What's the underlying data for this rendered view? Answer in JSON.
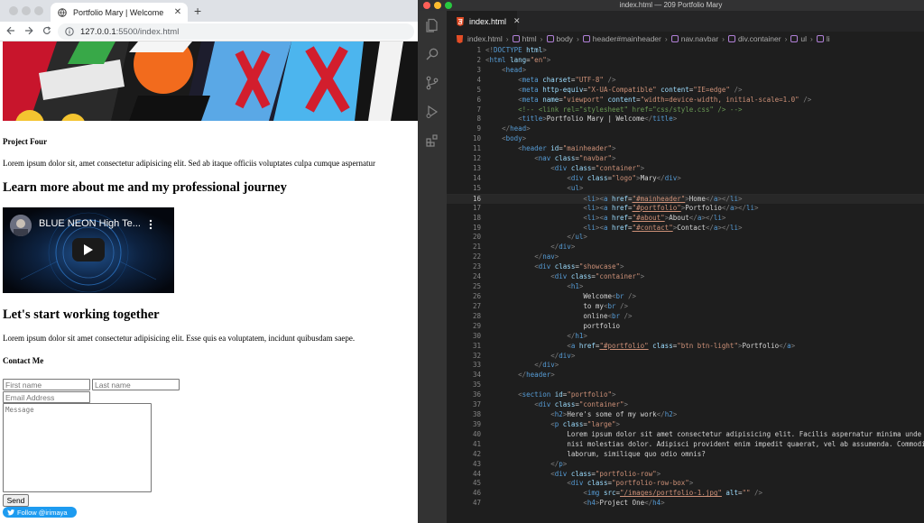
{
  "browser": {
    "tab_title": "Portfolio Mary | Welcome",
    "tab_close": "✕",
    "new_tab": "+",
    "url_host": "127.0.0.1",
    "url_rest": ":5500/index.html"
  },
  "page": {
    "project_heading": "Project Four",
    "project_text": "Lorem ipsum dolor sit, amet consectetur adipisicing elit. Sed ab itaque officiis voluptates culpa cumque aspernatur",
    "about_heading": "Learn more about me and my professional journey",
    "video_title": "BLUE NEON High Te...",
    "work_heading": "Let's start working together",
    "work_text": "Lorem ipsum dolor sit amet consectetur adipisicing elit. Esse quis ea voluptatem, incidunt quibusdam saepe.",
    "contact_heading": "Contact Me",
    "first_name_placeholder": "First name",
    "last_name_placeholder": "Last name",
    "email_placeholder": "Email Address",
    "message_placeholder": "Message",
    "send_label": "Send",
    "twitter_label": "Follow @irimaya"
  },
  "editor": {
    "window_title": "index.html — 209 Portfolio Mary",
    "tab_label": "index.html",
    "tab_close": "✕",
    "breadcrumbs": [
      "index.html",
      "html",
      "body",
      "header#mainheader",
      "nav.navbar",
      "div.container",
      "ul",
      "li"
    ],
    "current_line": 16,
    "lines": [
      "<!DOCTYPE html>",
      "<html lang=\"en\">",
      "    <head>",
      "        <meta charset=\"UTF-8\" />",
      "        <meta http-equiv=\"X-UA-Compatible\" content=\"IE=edge\" />",
      "        <meta name=\"viewport\" content=\"width=device-width, initial-scale=1.0\" />",
      "        <!-- <link rel=\"stylesheet\" href=\"css/style.css\" /> -->",
      "        <title>Portfolio Mary | Welcome</title>",
      "    </head>",
      "    <body>",
      "        <header id=\"mainheader\">",
      "            <nav class=\"navbar\">",
      "                <div class=\"container\">",
      "                    <div class=\"logo\">Mary</div>",
      "                    <ul>",
      "                        <li><a href=\"#mainheader\">Home</a></li>",
      "                        <li><a href=\"#portfolio\">Portfolio</a></li>",
      "                        <li><a href=\"#about\">About</a></li>",
      "                        <li><a href=\"#contact\">Contact</a></li>",
      "                    </ul>",
      "                </div>",
      "            </nav>",
      "            <div class=\"showcase\">",
      "                <div class=\"container\">",
      "                    <h1>",
      "                        Welcome<br />",
      "                        to my<br />",
      "                        online<br />",
      "                        portfolio",
      "                    </h1>",
      "                    <a href=\"#portfolio\" class=\"btn btn-light\">Portfolio</a>",
      "                </div>",
      "            </div>",
      "        </header>",
      "",
      "        <section id=\"portfolio\">",
      "            <div class=\"container\">",
      "                <h2>Here's some of my work</h2>",
      "                <p class=\"large\">",
      "                    Lorem ipsum dolor sit amet consectetur adipisicing elit. Facilis aspernatur minima unde",
      "                    nisi molestias dolor. Adipisci provident enim impedit quaerat, vel ab assumenda. Commodi",
      "                    laborum, similique quo odio omnis?",
      "                </p>",
      "                <div class=\"portfolio-row\">",
      "                    <div class=\"portfolio-row-box\">",
      "                        <img src=\"/images/portfolio-1.jpg\" alt=\"\" />",
      "                        <h4>Project One</h4>"
    ]
  }
}
